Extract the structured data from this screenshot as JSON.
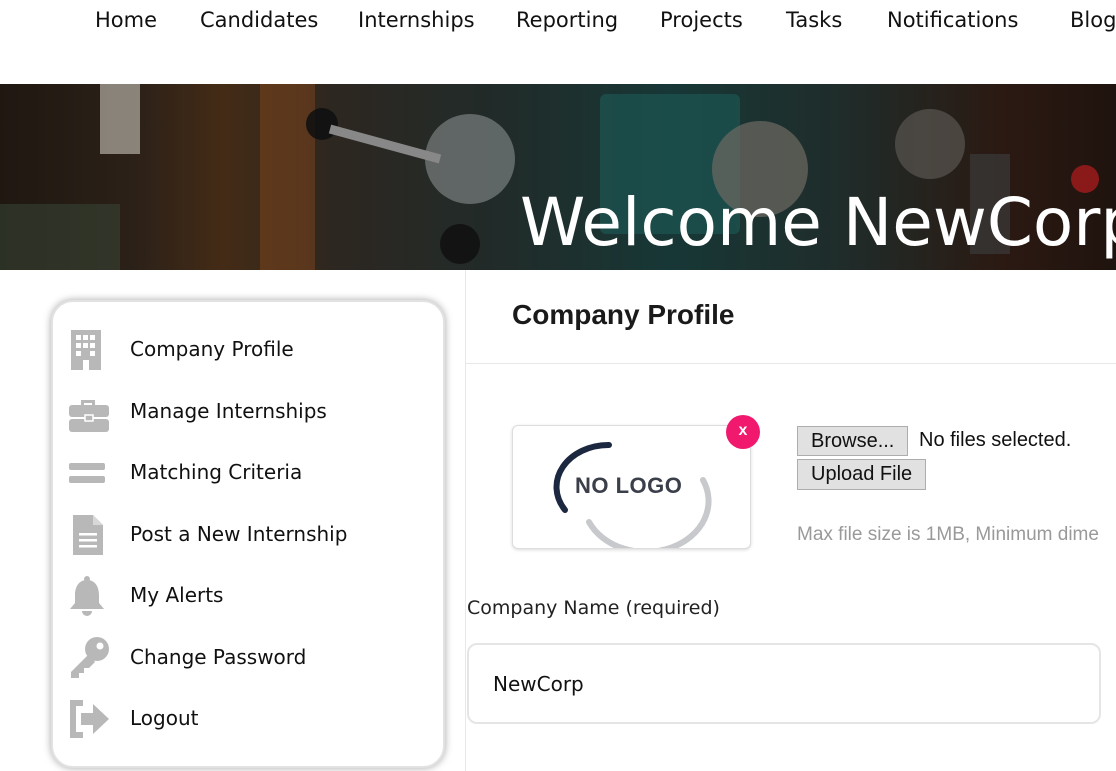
{
  "nav": {
    "items": [
      "Home",
      "Candidates",
      "Internships",
      "Reporting",
      "Projects",
      "Tasks",
      "Notifications",
      "Blog"
    ]
  },
  "hero": {
    "title": "Welcome NewCorp"
  },
  "sidebar": {
    "items": [
      {
        "label": "Company Profile",
        "icon": "building-icon"
      },
      {
        "label": "Manage Internships",
        "icon": "briefcase-icon"
      },
      {
        "label": "Matching Criteria",
        "icon": "equals-icon"
      },
      {
        "label": "Post a New Internship",
        "icon": "document-icon"
      },
      {
        "label": "My Alerts",
        "icon": "bell-icon"
      },
      {
        "label": "Change Password",
        "icon": "key-icon"
      },
      {
        "label": "Logout",
        "icon": "logout-icon"
      }
    ]
  },
  "main": {
    "title": "Company Profile",
    "logo": {
      "placeholder_text": "NO LOGO",
      "remove_label": "x"
    },
    "upload": {
      "browse_label": "Browse...",
      "file_status": "No files selected.",
      "upload_label": "Upload File",
      "hint": "Max file size is 1MB, Minimum dime"
    },
    "company_name": {
      "label": "Company Name (required)",
      "value": "NewCorp"
    }
  },
  "colors": {
    "accent_remove": "#f0196e",
    "icon_gray": "#b8b8b8"
  }
}
